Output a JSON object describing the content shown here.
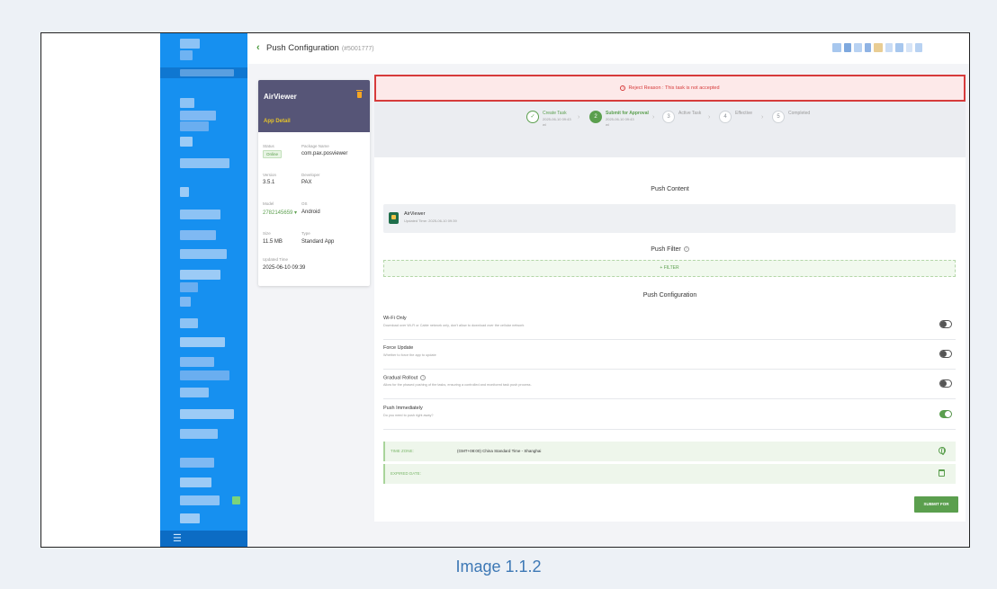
{
  "header": {
    "back_icon": "chevron-left-icon",
    "title": "Push Configuration",
    "title_id": "(#5001777)"
  },
  "app_card": {
    "name": "AirViewer",
    "tab": "App Detail",
    "delete_icon": "trash-icon",
    "fields": {
      "status_label": "Status",
      "status_value": "Online",
      "package_label": "Package Name",
      "package_value": "com.pax.posviewer",
      "version_label": "Version",
      "version_value": "3.5.1",
      "developer_label": "Developer",
      "developer_value": "PAX",
      "model_label": "Model",
      "model_value": "2782145659",
      "os_label": "OS",
      "os_value": "Android",
      "size_label": "Size",
      "size_value": "11.5 MB",
      "type_label": "Type",
      "type_value": "Standard App",
      "updated_label": "Updated Time",
      "updated_value": "2025-06-10 09:39"
    }
  },
  "reject": {
    "text": "Reject Reason : This task is not accepted",
    "icon": "warning-circle-icon"
  },
  "steps": [
    {
      "num": "✓",
      "title": "Create Task",
      "date": "2025-06-10 09:43",
      "by": "wl",
      "state": "done"
    },
    {
      "num": "2",
      "title": "Submit for Approval",
      "date": "2025-06-10 09:43",
      "by": "wl",
      "state": "active"
    },
    {
      "num": "3",
      "title": "Active Task",
      "date": "",
      "by": "",
      "state": "todo"
    },
    {
      "num": "4",
      "title": "Effective",
      "date": "",
      "by": "",
      "state": "todo"
    },
    {
      "num": "5",
      "title": "Completed",
      "date": "",
      "by": "",
      "state": "todo"
    }
  ],
  "push_content": {
    "title": "Push Content",
    "app_name": "AirViewer",
    "app_time": "Updated Time: 2025-06-10 09:39"
  },
  "push_filter": {
    "title": "Push Filter",
    "button": "+ FILTER"
  },
  "push_config": {
    "title": "Push Configuration",
    "rows": [
      {
        "title": "Wi-Fi Only",
        "desc": "Download over Wi-Fi or Cable network only, don't allow to download over the cellular network",
        "on": false
      },
      {
        "title": "Force Update",
        "desc": "Whether to force the app to update",
        "on": false
      },
      {
        "title": "Gradual Rollout",
        "desc": "Allow for the phased pushing of the tasks, ensuring a controlled and monitored task push process.",
        "on": false
      },
      {
        "title": "Push Immediately",
        "desc": "Do you need to push right away?",
        "on": true
      }
    ],
    "timezone_label": "TIME ZONE:",
    "timezone_value": "(GMT+08:00) China Standard Time - Shanghai",
    "expired_label": "EXPIRED DATE:",
    "submit": "SUBMIT FOR APPROVAL"
  },
  "sidebar": {
    "footer_icon": "menu-icon",
    "footer_glyph": "☰"
  },
  "caption": "Image 1.1.2",
  "colors": {
    "accent": "#5b9f4e",
    "sidebar": "#1690f0",
    "reject": "#d63b3b",
    "app_header": "#565577"
  }
}
